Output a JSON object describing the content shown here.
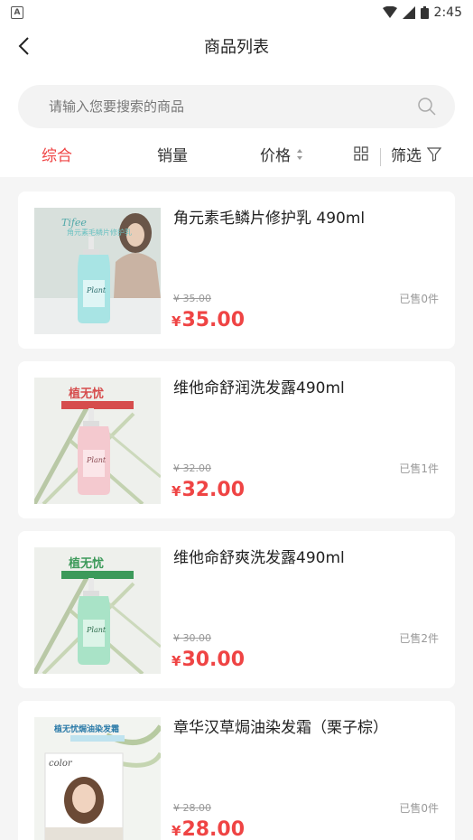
{
  "status": {
    "time": "2:45"
  },
  "header": {
    "title": "商品列表"
  },
  "search": {
    "placeholder": "请输入您要搜索的商品"
  },
  "filters": {
    "comprehensive": "综合",
    "sales": "销量",
    "price": "价格",
    "filter": "筛选"
  },
  "colors": {
    "accent": "#ef4444"
  },
  "products": [
    {
      "name": "角元素毛鳞片修护乳 490ml",
      "old_price": "¥ 35.00",
      "sold": "已售0件",
      "currency": "¥",
      "price": "35.00",
      "image_text": "角元素毛鳞片修护乳"
    },
    {
      "name": "维他命舒润洗发露490ml",
      "old_price": "¥ 32.00",
      "sold": "已售1件",
      "currency": "¥",
      "price": "32.00",
      "image_text": "植无忧"
    },
    {
      "name": "维他命舒爽洗发露490ml",
      "old_price": "¥ 30.00",
      "sold": "已售2件",
      "currency": "¥",
      "price": "30.00",
      "image_text": "植无忧"
    },
    {
      "name": "章华汉草焗油染发霜（栗子棕）",
      "old_price": "¥ 28.00",
      "sold": "已售0件",
      "currency": "¥",
      "price": "28.00",
      "image_text": "植无忧焗油染发霜"
    }
  ]
}
